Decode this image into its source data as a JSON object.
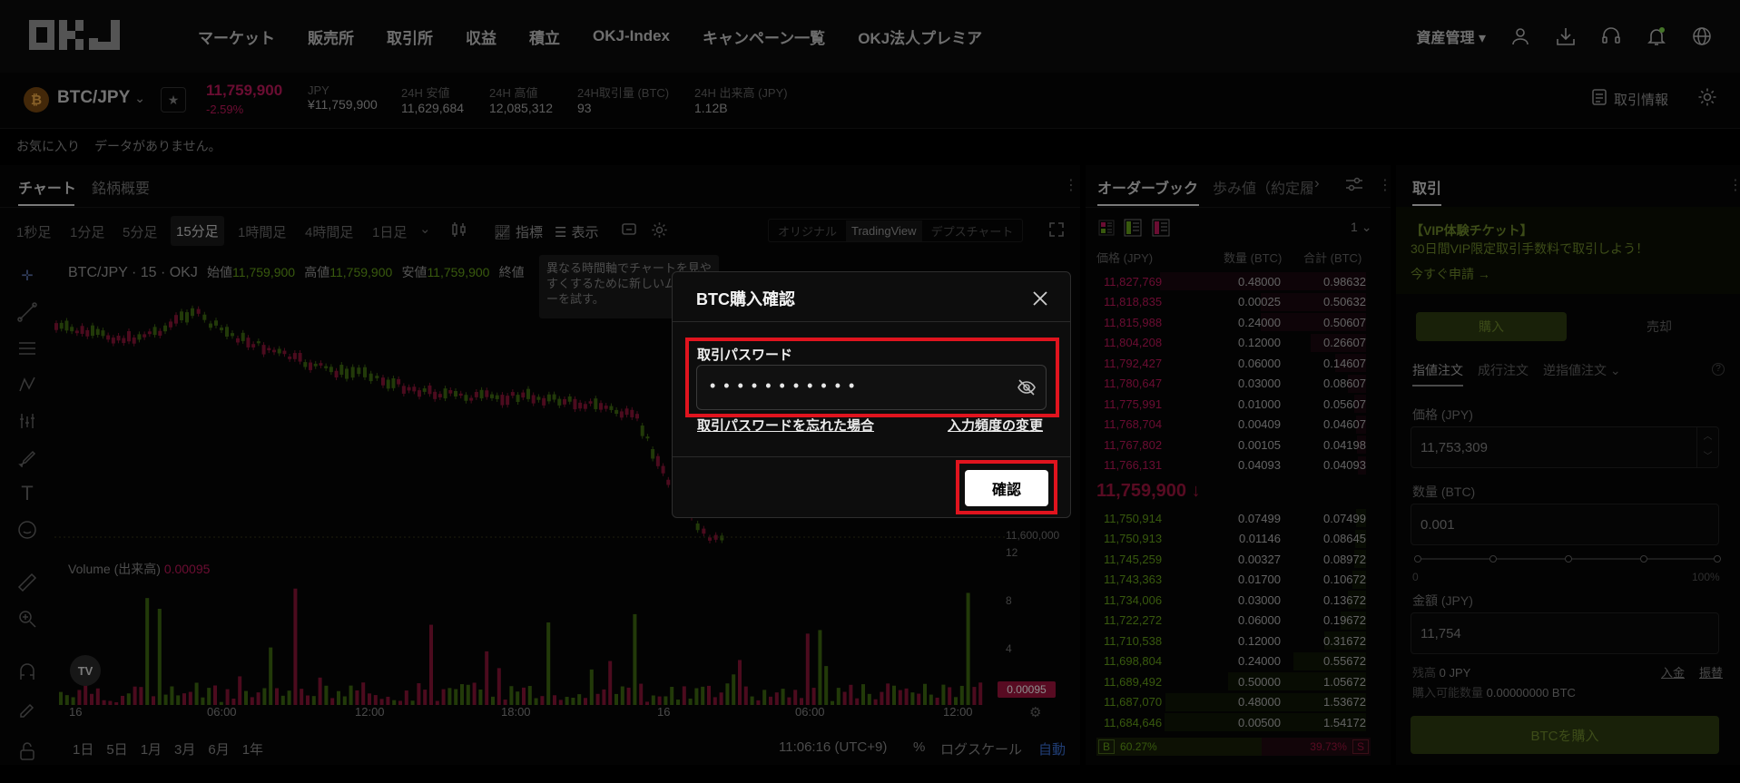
{
  "colors": {
    "up": "#67a31a",
    "down": "#c2185b",
    "accent": "#8bc34a",
    "danger": "#e0141e"
  },
  "topnav": {
    "logo": "OKJ",
    "items": [
      "マーケット",
      "販売所",
      "取引所",
      "収益",
      "積立",
      "OKJ-Index",
      "キャンペーン一覧",
      "OKJ法人プレミア"
    ],
    "asset_menu": "資産管理"
  },
  "ticker": {
    "pair": "BTC/JPY",
    "price": "11,759,900",
    "change": "-2.59%",
    "stats": [
      {
        "label": "JPY",
        "value": "¥11,759,900"
      },
      {
        "label": "24H 安値",
        "value": "11,629,684"
      },
      {
        "label": "24H 高値",
        "value": "12,085,312"
      },
      {
        "label": "24H取引量 (BTC)",
        "value": "93"
      },
      {
        "label": "24H 出来高 (JPY)",
        "value": "1.12B"
      }
    ],
    "info_link": "取引情報"
  },
  "favorites": {
    "label": "お気に入り",
    "empty": "データがありません。"
  },
  "chart": {
    "tabs": [
      "チャート",
      "銘柄概要"
    ],
    "timeframes": [
      "1秒足",
      "1分足",
      "5分足",
      "15分足",
      "1時間足",
      "4時間足",
      "1日足"
    ],
    "active_timeframe": "15分足",
    "indicators_label": "指標",
    "display_label": "表示",
    "views": [
      "オリジナル",
      "TradingView",
      "デプスチャート"
    ],
    "active_view": "TradingView",
    "legend": {
      "symbol": "BTC/JPY · 15 · OKJ",
      "open_lbl": "始値",
      "open": "11,759,900",
      "high_lbl": "高値",
      "high": "11,759,900",
      "low_lbl": "安値",
      "low": "11,759,900",
      "close_lbl": "終値"
    },
    "tooltip": "異なる時間軸でチャートを見やすくするために新しいムアンカーを試す。",
    "price_axis_label": "11,600,000",
    "volume_label": "Volume (出来高)",
    "volume_value": "0.00095",
    "volume_ticks": [
      "12",
      "8",
      "4"
    ],
    "volume_badge": "0.00095",
    "time_ticks": [
      "16",
      "06:00",
      "12:00",
      "18:00",
      "16",
      "06:00",
      "12:00"
    ],
    "ranges": [
      "1日",
      "5日",
      "1月",
      "3月",
      "6月",
      "1年"
    ],
    "clock": "11:06:16 (UTC+9)",
    "pct": "%",
    "log": "ログスケール",
    "auto": "自動"
  },
  "orderbook": {
    "tabs": [
      "オーダーブック",
      "歩み値（約定履"
    ],
    "precision": "1",
    "headers": [
      "価格 (JPY)",
      "数量 (BTC)",
      "合計 (BTC)"
    ],
    "asks": [
      [
        "11,827,769",
        "0.48000",
        "0.98632"
      ],
      [
        "11,818,835",
        "0.00025",
        "0.50632"
      ],
      [
        "11,815,988",
        "0.24000",
        "0.50607"
      ],
      [
        "11,804,208",
        "0.12000",
        "0.26607"
      ],
      [
        "11,792,427",
        "0.06000",
        "0.14607"
      ],
      [
        "11,780,647",
        "0.03000",
        "0.08607"
      ],
      [
        "11,775,991",
        "0.01000",
        "0.05607"
      ],
      [
        "11,768,704",
        "0.00409",
        "0.04607"
      ],
      [
        "11,767,802",
        "0.00105",
        "0.04198"
      ],
      [
        "11,766,131",
        "0.04093",
        "0.04093"
      ]
    ],
    "mid": "11,759,900",
    "bids": [
      [
        "11,750,914",
        "0.07499",
        "0.07499"
      ],
      [
        "11,750,913",
        "0.01146",
        "0.08645"
      ],
      [
        "11,745,259",
        "0.00327",
        "0.08972"
      ],
      [
        "11,743,363",
        "0.01700",
        "0.10672"
      ],
      [
        "11,734,006",
        "0.03000",
        "0.13672"
      ],
      [
        "11,722,272",
        "0.06000",
        "0.19672"
      ],
      [
        "11,710,538",
        "0.12000",
        "0.31672"
      ],
      [
        "11,698,804",
        "0.24000",
        "0.55672"
      ],
      [
        "11,689,492",
        "0.50000",
        "1.05672"
      ],
      [
        "11,687,070",
        "0.48000",
        "1.53672"
      ],
      [
        "11,684,646",
        "0.00500",
        "1.54172"
      ]
    ],
    "buy_ratio_label": "B",
    "buy_ratio": "60.27%",
    "sell_ratio": "39.73%",
    "sell_ratio_label": "S"
  },
  "trade": {
    "title": "取引",
    "promo_title": "【VIP体験チケット】",
    "promo_text": "30日間VIP限定取引手数料で取引しよう！",
    "promo_link": "今すぐ申請 →",
    "buy_tab": "購入",
    "sell_tab": "売却",
    "order_types": [
      "指値注文",
      "成行注文",
      "逆指値注文"
    ],
    "price_label": "価格 (JPY)",
    "price_value": "11,753,309",
    "qty_label": "数量 (BTC)",
    "qty_value": "0.001",
    "slider_min": "0",
    "slider_max": "100%",
    "amount_label": "金額 (JPY)",
    "amount_value": "11,754",
    "balance_label": "残高",
    "balance_value": "0 JPY",
    "deposit": "入金",
    "transfer": "振替",
    "available_label": "購入可能数量",
    "available_value": "0.00000000 BTC",
    "buy_button": "BTCを購入"
  },
  "modal": {
    "title": "BTC購入確認",
    "password_label": "取引パスワード",
    "password_mask": "• • • • • • • • • • •",
    "forgot_link": "取引パスワードを忘れた場合",
    "frequency_link": "入力頻度の変更",
    "confirm_button": "確認"
  }
}
